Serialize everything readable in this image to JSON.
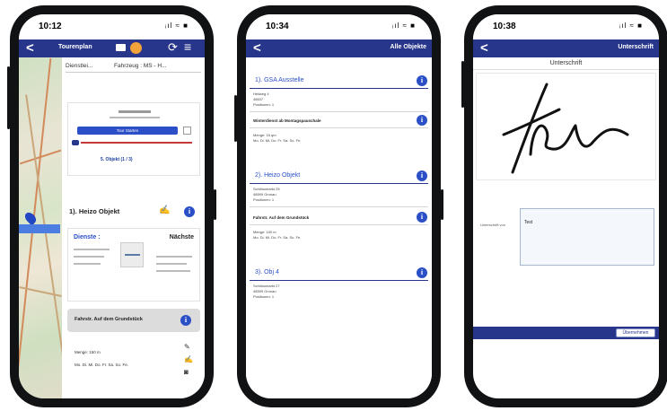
{
  "colors": {
    "nav": "#27368a",
    "accent": "#2b4fc7",
    "route_line": "#c43a3a",
    "highlight_box": "#dcdcdc"
  },
  "phone1": {
    "time": "10:12",
    "status_icons": "ᵢıl ≈ ■",
    "nav_back": "<",
    "nav_title": "Tourenplan",
    "tabs": [
      "Dienstlei...",
      "Fahrzeug : MS - H..."
    ],
    "route_card": {
      "icons": [
        "calendar-icon",
        "bus-icon"
      ],
      "start_label": "Tour Starten",
      "count_label": "5. Objekt (1 / 3)"
    },
    "object_title": "1). Heizo Objekt",
    "service": {
      "title": "Dienste :",
      "right_title": "Nächste"
    },
    "drive_label": "Fahrstr. Auf dem Grundstück",
    "qty_label": "Menge: 150 m",
    "days_label": "Mo. Di. Mi. Do. Fr. Sa. So. Fe."
  },
  "phone2": {
    "time": "10:34",
    "status_icons": "ᵢıl ≈ ■",
    "nav_back": "<",
    "nav_title": "Alle Objekte",
    "sections": [
      {
        "title": "1). GSA Ausstelle",
        "meta": [
          "Heilweg 4",
          "48637",
          "Positionen: 1"
        ],
        "sub": "Winterdienst ab Montagspauschale",
        "sub_meta": [
          "Menge: 15 qm",
          "Mo. Di. Mi. Do. Fr. Sa. So. Fe."
        ]
      },
      {
        "title": "2). Heizo Objekt",
        "meta": [
          "Schlössmarkt 25",
          "48599 Gronau",
          "Positionen: 1"
        ],
        "sub": "Fahrstr. Auf dem Grundstück",
        "sub_meta": [
          "Menge: 150 m",
          "Mo. Di. Mi. Do. Fr. Sa. So. Fe."
        ]
      },
      {
        "title": "3). Obj 4",
        "meta": [
          "Schlössmarkt 27",
          "48599 Gronau",
          "Positionen: 1"
        ]
      }
    ]
  },
  "phone3": {
    "time": "10:38",
    "status_icons": "ᵢıl ≈ ■",
    "nav_back": "<",
    "nav_title": "Unterschrift",
    "heading": "Unterschrift",
    "name_label": "Unterschrift von",
    "name_value": "Test",
    "apply_label": "Übernehmen"
  }
}
